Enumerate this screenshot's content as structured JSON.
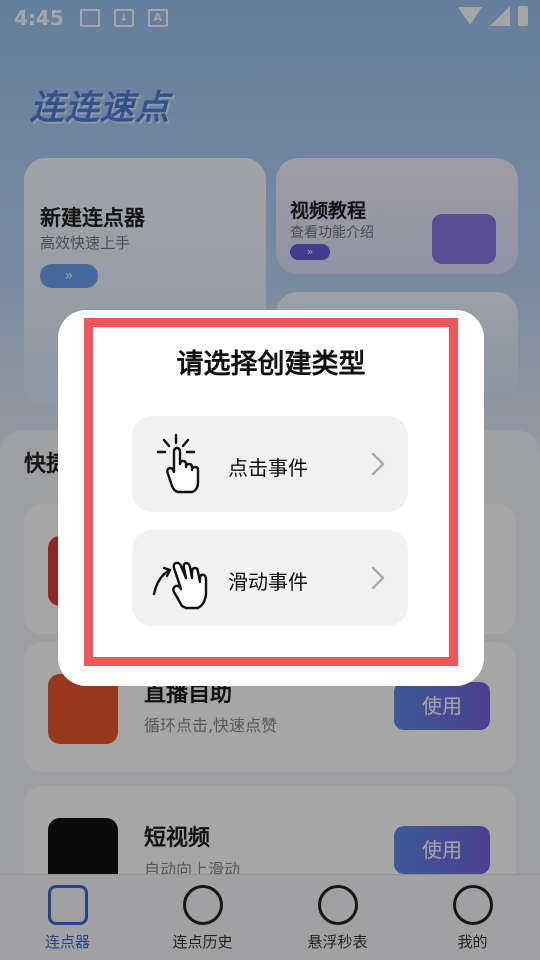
{
  "status_bar": {
    "time": "4:45"
  },
  "brand": "连连速点",
  "cards": {
    "new_clicker": {
      "title": "新建连点器",
      "subtitle": "高效快速上手",
      "go": "»"
    },
    "video_tutorial": {
      "title": "视频教程",
      "subtitle": "查看功能介绍",
      "go": "»"
    }
  },
  "section": {
    "title": "快捷",
    "items": [
      {
        "name": "",
        "desc": "",
        "use": "",
        "icon_color": "#e13b3b"
      },
      {
        "name": "直播自助",
        "desc": "循环点击,快速点赞",
        "use": "使用",
        "icon_color": "#e9572b"
      },
      {
        "name": "短视频",
        "desc": "自动向上滑动",
        "use": "使用",
        "icon_color": "#111111"
      }
    ]
  },
  "tabs": [
    {
      "label": "连点器",
      "icon": "tap-hand-icon",
      "active": true
    },
    {
      "label": "连点历史",
      "icon": "history-icon",
      "active": false
    },
    {
      "label": "悬浮秒表",
      "icon": "stopwatch-icon",
      "active": false
    },
    {
      "label": "我的",
      "icon": "profile-face-icon",
      "active": false
    }
  ],
  "dialog": {
    "title": "请选择创建类型",
    "options": [
      {
        "label": "点击事件",
        "icon": "tap-hand-icon"
      },
      {
        "label": "滑动事件",
        "icon": "swipe-hand-icon"
      }
    ]
  },
  "colors": {
    "accent": "#3d6bd6",
    "highlight": "#f2555a",
    "use_button_start": "#5d8ae8",
    "use_button_end": "#7561dc"
  }
}
